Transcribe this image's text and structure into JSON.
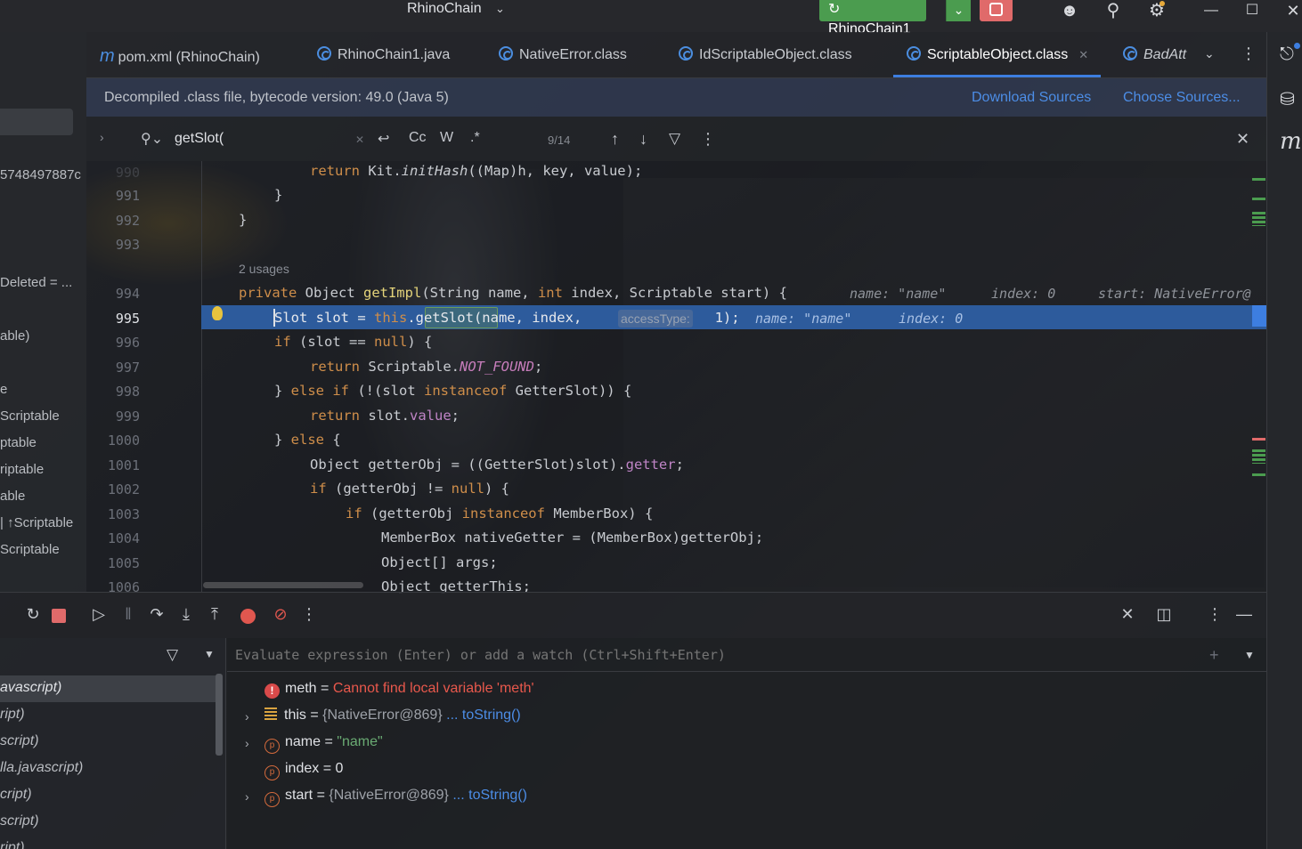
{
  "titlebar": {
    "project": "RhinoChain",
    "run_config": "RhinoChain1"
  },
  "left_panel": {
    "items": [
      "5748497887с",
      "Deleted = ...",
      "able)",
      "e",
      "Scriptable",
      "ptable",
      "riptable",
      "able",
      "| ↑Scriptable",
      "Scriptable"
    ]
  },
  "tabs": [
    {
      "label": "pom.xml (RhinoChain)"
    },
    {
      "label": "RhinoChain1.java"
    },
    {
      "label": "NativeError.class"
    },
    {
      "label": "IdScriptableObject.class"
    },
    {
      "label": "ScriptableObject.class"
    },
    {
      "label": "BadAtt"
    }
  ],
  "banner": {
    "text": "Decompiled .class file, bytecode version: 49.0 (Java 5)",
    "download": "Download Sources",
    "choose": "Choose Sources..."
  },
  "search": {
    "query": "getSlot(",
    "match_case": "Cc",
    "words": "W",
    "regex": ".*",
    "count": "9/14"
  },
  "editor": {
    "usages": "2 usages",
    "line_numbers": [
      "990",
      "991",
      "992",
      "993",
      "994",
      "995",
      "996",
      "997",
      "998",
      "999",
      "1000",
      "1001",
      "1002",
      "1003",
      "1004",
      "1005",
      "1006"
    ],
    "hints": {
      "name": "name: \"name\"",
      "index": "index: 0",
      "start": "start: NativeError@",
      "exec_name": "name: \"name\"",
      "exec_index": "index: 0",
      "access_type": "accessType:"
    }
  },
  "variables": {
    "eval_placeholder": "Evaluate expression (Enter) or add a watch (Ctrl+Shift+Enter)",
    "items": [
      {
        "name": "meth",
        "eq": " = ",
        "value": "Cannot find local variable 'meth'"
      },
      {
        "name": "this",
        "eq": " = ",
        "value": "{NativeError@869}",
        "link": "... toString()"
      },
      {
        "name": "name",
        "eq": " = ",
        "value": "\"name\""
      },
      {
        "name": "index",
        "eq": " = ",
        "value": "0"
      },
      {
        "name": "start",
        "eq": " = ",
        "value": "{NativeError@869}",
        "link": "... toString()"
      }
    ]
  },
  "frames": {
    "items": [
      "avascript)",
      "ript)",
      "script)",
      "lla.javascript)",
      "cript)",
      "script)",
      "ript)"
    ]
  },
  "colors": {
    "accent": "#3d7ee0",
    "run_green": "#4b9c4f",
    "stop_red": "#e06a6a",
    "exec_line": "#2d5b9c",
    "error": "#e8584c"
  }
}
